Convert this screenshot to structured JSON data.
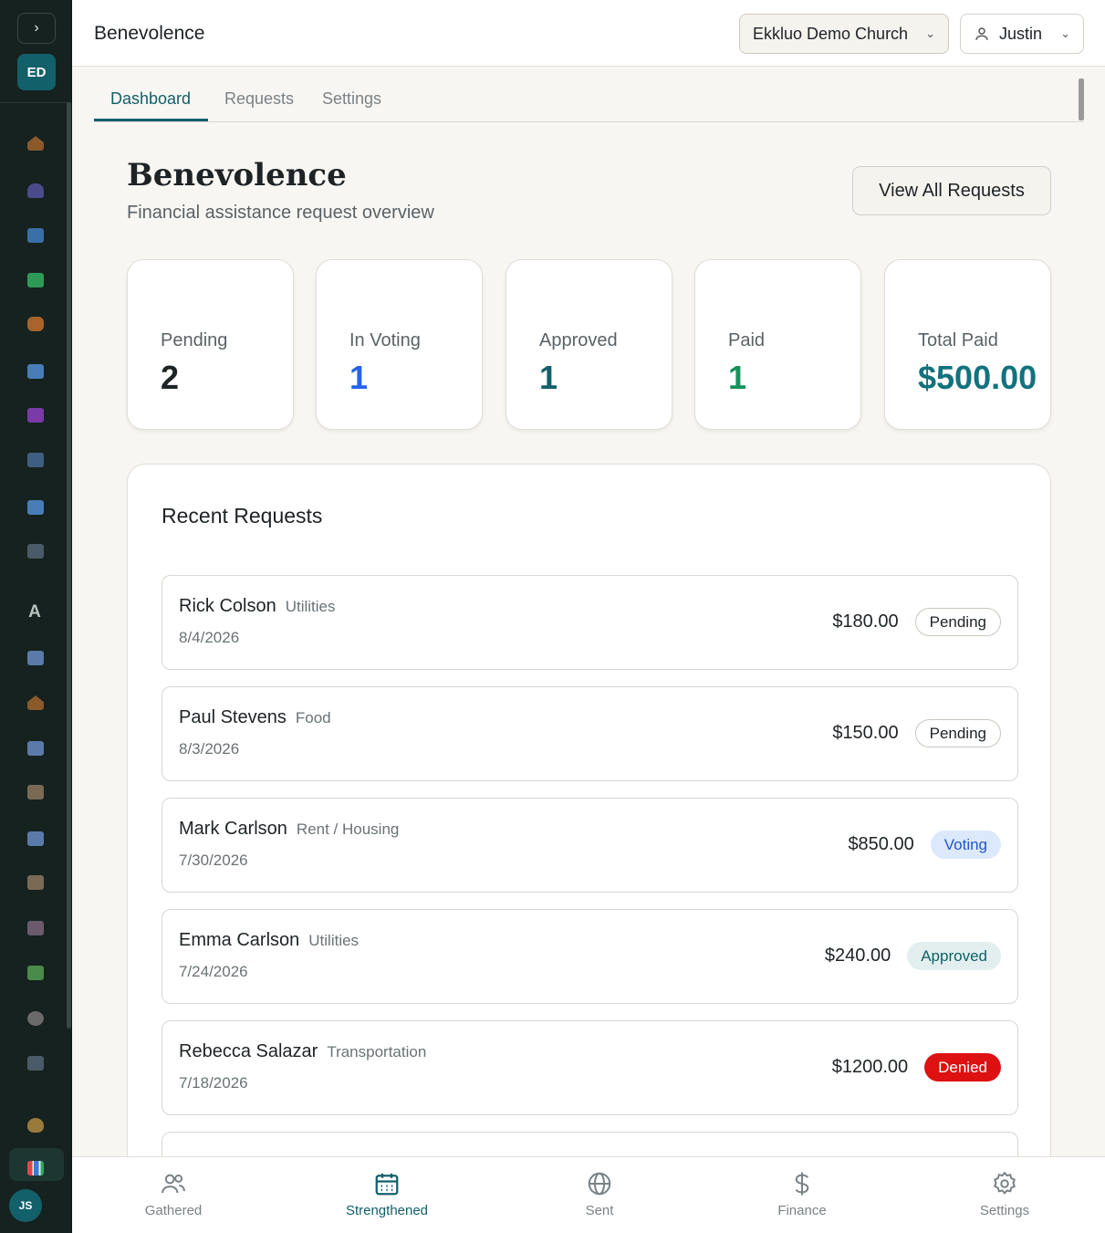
{
  "app": {
    "title": "Benevolence",
    "org_name": "Ekkluo Demo Church",
    "user_name": "Justin",
    "org_initials": "ED",
    "user_initials": "JS"
  },
  "sidebar": {
    "letter_item": "A"
  },
  "tabs": [
    {
      "label": "Dashboard",
      "active": true
    },
    {
      "label": "Requests",
      "active": false
    },
    {
      "label": "Settings",
      "active": false
    }
  ],
  "page": {
    "title": "Benevolence",
    "subtitle": "Financial assistance request overview",
    "view_all_label": "View All Requests"
  },
  "stats": [
    {
      "label": "Pending",
      "value": "2",
      "color": "#1e2326"
    },
    {
      "label": "In Voting",
      "value": "1",
      "color": "#2563eb"
    },
    {
      "label": "Approved",
      "value": "1",
      "color": "#12606a"
    },
    {
      "label": "Paid",
      "value": "1",
      "color": "#15925a"
    },
    {
      "label": "Total Paid",
      "value": "$500.00",
      "color": "#12727e"
    }
  ],
  "recent": {
    "title": "Recent Requests",
    "items": [
      {
        "name": "Rick Colson",
        "category": "Utilities",
        "date": "8/4/2026",
        "amount": "$180.00",
        "status": "Pending",
        "status_class": "pending"
      },
      {
        "name": "Paul Stevens",
        "category": "Food",
        "date": "8/3/2026",
        "amount": "$150.00",
        "status": "Pending",
        "status_class": "pending"
      },
      {
        "name": "Mark Carlson",
        "category": "Rent / Housing",
        "date": "7/30/2026",
        "amount": "$850.00",
        "status": "Voting",
        "status_class": "voting"
      },
      {
        "name": "Emma Carlson",
        "category": "Utilities",
        "date": "7/24/2026",
        "amount": "$240.00",
        "status": "Approved",
        "status_class": "approved"
      },
      {
        "name": "Rebecca Salazar",
        "category": "Transportation",
        "date": "7/18/2026",
        "amount": "$1200.00",
        "status": "Denied",
        "status_class": "denied"
      }
    ]
  },
  "bottom_nav": [
    {
      "label": "Gathered",
      "icon": "people-icon",
      "active": false
    },
    {
      "label": "Strengthened",
      "icon": "calendar-icon",
      "active": true
    },
    {
      "label": "Sent",
      "icon": "globe-icon",
      "active": false
    },
    {
      "label": "Finance",
      "icon": "dollar-icon",
      "active": false
    },
    {
      "label": "Settings",
      "icon": "gear-icon",
      "active": false
    }
  ]
}
